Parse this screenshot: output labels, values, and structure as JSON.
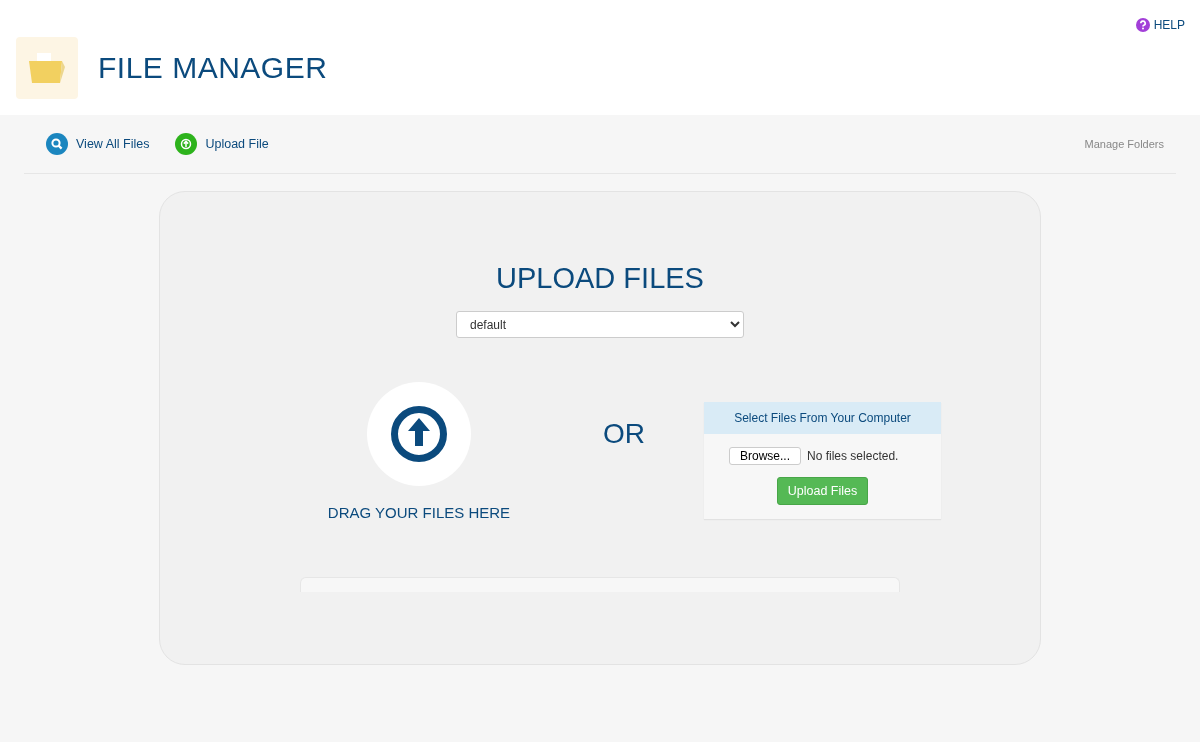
{
  "header": {
    "title": "FILE MANAGER",
    "help": "HELP"
  },
  "nav": {
    "links": [
      {
        "label": "View All Files",
        "kind": "search"
      },
      {
        "label": "Upload File",
        "kind": "upload"
      }
    ],
    "manage": "Manage Folders"
  },
  "upload": {
    "title": "UPLOAD FILES",
    "folder": "default",
    "drag_label": "DRAG YOUR FILES HERE",
    "or": "OR",
    "panel": {
      "heading": "Select Files From Your Computer",
      "browse": "Browse...",
      "status": "No files selected.",
      "button": "Upload Files"
    },
    "progress": {
      "level": 0
    }
  }
}
